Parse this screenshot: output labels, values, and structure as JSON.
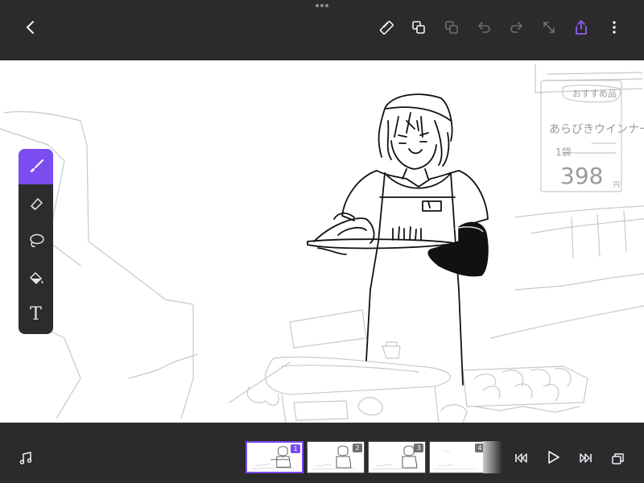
{
  "toolbar": {
    "back_icon": "chevron-left-icon",
    "right_icons": [
      "ruler-icon",
      "layers-copy-icon",
      "duplicate-frame-icon",
      "undo-icon",
      "redo-icon",
      "expand-icon",
      "share-icon",
      "more-icon"
    ],
    "accent_color": "#7b4cf0"
  },
  "tools": {
    "items": [
      "brush-tool",
      "eraser-tool",
      "lasso-tool",
      "fill-tool",
      "text-tool"
    ],
    "active": "brush-tool",
    "text_tool_glyph": "T"
  },
  "sign": {
    "line1": "おすすめ品",
    "line2": "あらびきウインナー",
    "line3": "1袋",
    "price": "398",
    "unit": "円"
  },
  "timeline": {
    "frames": [
      {
        "number": "1",
        "selected": true
      },
      {
        "number": "2",
        "selected": false
      },
      {
        "number": "3",
        "selected": false
      },
      {
        "number": "4",
        "selected": false
      }
    ],
    "controls": [
      "music-icon",
      "skip-to-start-icon",
      "play-icon",
      "skip-to-end-icon",
      "onion-skin-icon"
    ]
  }
}
